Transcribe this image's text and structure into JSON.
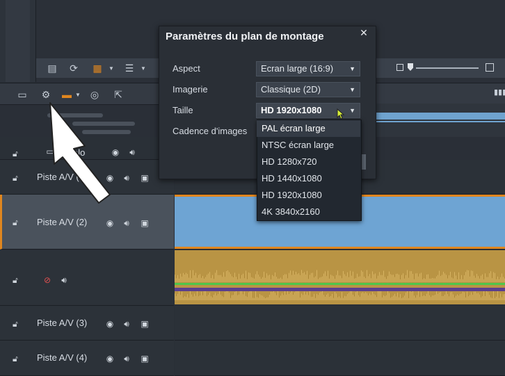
{
  "dialog": {
    "title": "Paramètres du plan de montage",
    "close_label": "✕",
    "fields": [
      {
        "label": "Aspect",
        "value": "Ecran large (16:9)"
      },
      {
        "label": "Imagerie",
        "value": "Classique (2D)"
      },
      {
        "label": "Taille",
        "value": "HD 1920x1080"
      },
      {
        "label": "Cadence d'images",
        "value": ""
      }
    ]
  },
  "size_dropdown": {
    "options": [
      "PAL écran large",
      "NTSC écran large",
      "HD 1280x720",
      "HD 1440x1080",
      "HD 1920x1080",
      "4K 3840x2160"
    ],
    "highlighted": "PAL écran large"
  },
  "tracks": [
    {
      "label": "Piste A/V (1)"
    },
    {
      "label": "Piste A/V (2)"
    },
    {
      "label": ""
    },
    {
      "label": "Piste A/V (3)"
    },
    {
      "label": "Piste A/V (4)"
    }
  ],
  "solo_label": "olo",
  "colors": {
    "accent": "#e0861f",
    "video_clip": "#6ea4d3",
    "audio_clip": "#b99444",
    "audio_level": "#4fc64b"
  }
}
